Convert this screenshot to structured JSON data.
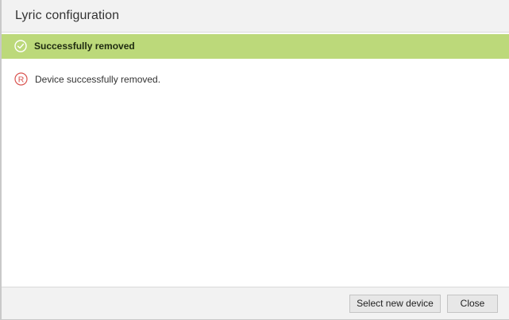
{
  "dialog": {
    "title": "Lyric configuration"
  },
  "banner": {
    "icon": "check-circle-icon",
    "text": "Successfully removed",
    "color": "#bcd97a"
  },
  "message": {
    "icon": "registered-circle-icon",
    "text": "Device successfully removed.",
    "icon_color": "#d9534f"
  },
  "footer": {
    "select_new_device_label": "Select new device",
    "close_label": "Close"
  }
}
